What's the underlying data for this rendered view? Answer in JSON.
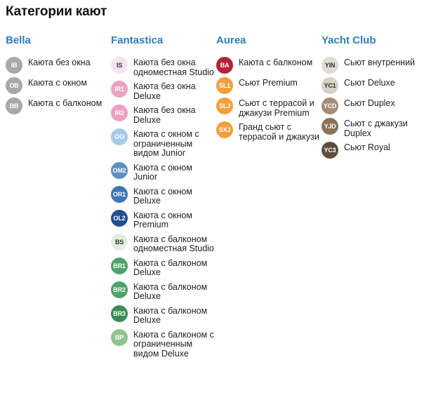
{
  "title": "Категории кают",
  "columns": [
    {
      "name": "Bella",
      "items": [
        {
          "code": "IB",
          "label": "Каюта без окна",
          "color": "#a8a8a8"
        },
        {
          "code": "OB",
          "label": "Каюта с окном",
          "color": "#a8a8a8"
        },
        {
          "code": "BB",
          "label": "Каюта с балконом",
          "color": "#a8a8a8"
        }
      ]
    },
    {
      "name": "Fantastica",
      "items": [
        {
          "code": "IS",
          "label": "Каюта без окна одноместная Studio",
          "color": "#f6e3ef"
        },
        {
          "code": "IR1",
          "label": "Каюта без окна Deluxe",
          "color": "#ef9fc3"
        },
        {
          "code": "IR2",
          "label": "Каюта без окна Deluxe",
          "color": "#ef9fc3"
        },
        {
          "code": "OO",
          "label": "Каюта с окном с ограниченным видом Junior",
          "color": "#a6cbe8"
        },
        {
          "code": "OM2",
          "label": "Каюта с окном Junior",
          "color": "#5d8fc5"
        },
        {
          "code": "OR1",
          "label": "Каюта с окном Deluxe",
          "color": "#3e77b8"
        },
        {
          "code": "OL2",
          "label": "Каюта с окном Premium",
          "color": "#214f93"
        },
        {
          "code": "BS",
          "label": "Каюта с балконом одноместная Studio",
          "color": "#e4eedf"
        },
        {
          "code": "BR1",
          "label": "Каюта с балконом Deluxe",
          "color": "#4ea36c"
        },
        {
          "code": "BR2",
          "label": "Каюта с балконом Deluxe",
          "color": "#4ea36c"
        },
        {
          "code": "BR3",
          "label": "Каюта с балконом Deluxe",
          "color": "#3c8b57"
        },
        {
          "code": "BP",
          "label": "Каюта с балконом с ограниченным видом Deluxe",
          "color": "#8fc38f"
        }
      ]
    },
    {
      "name": "Aurea",
      "items": [
        {
          "code": "BA",
          "label": "Каюта с балконом",
          "color": "#b6213a"
        },
        {
          "code": "SL1",
          "label": "Сьют Premium",
          "color": "#f2a03f"
        },
        {
          "code": "SLJ",
          "label": "Сьют с террасой и джакузи Premium",
          "color": "#f2a03f"
        },
        {
          "code": "SXJ",
          "label": "Гранд сьют с террасой и джакузи",
          "color": "#f2a03f"
        }
      ]
    },
    {
      "name": "Yacht Club",
      "items": [
        {
          "code": "YIN",
          "label": "Сьют внутренний",
          "color": "#e0dcd4"
        },
        {
          "code": "YC1",
          "label": "Сьют Deluxe",
          "color": "#d8d2c4"
        },
        {
          "code": "YCD",
          "label": "Сьют Duplex",
          "color": "#a48c76"
        },
        {
          "code": "YJD",
          "label": "Сьют с джакузи Duplex",
          "color": "#8c7258"
        },
        {
          "code": "YC3",
          "label": "Сьют Royal",
          "color": "#5e4d3e"
        }
      ]
    }
  ]
}
